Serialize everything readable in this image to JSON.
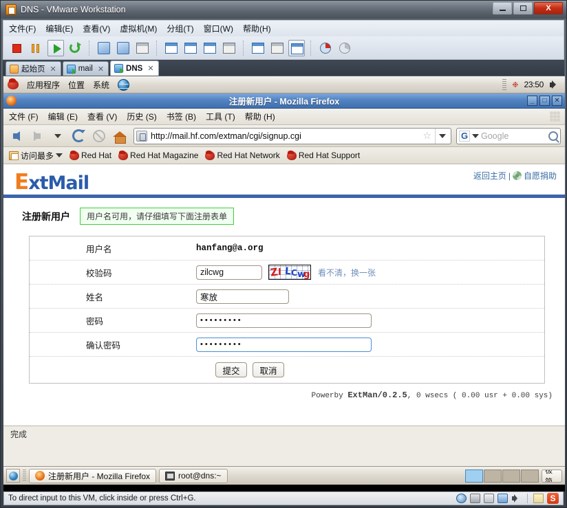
{
  "vmware": {
    "title": "DNS - VMware Workstation",
    "window_controls": {
      "minimize": "–",
      "maximize": "□",
      "close": "X"
    },
    "menus": [
      "文件(F)",
      "编辑(E)",
      "查看(V)",
      "虚拟机(M)",
      "分组(T)",
      "窗口(W)",
      "帮助(H)"
    ],
    "tabs": [
      {
        "label": "起始页",
        "close": "✕",
        "icon": "home-icon"
      },
      {
        "label": "mail",
        "close": "✕",
        "icon": "vm-icon"
      },
      {
        "label": "DNS",
        "close": "✕",
        "icon": "vm-icon"
      }
    ],
    "status_text": "To direct input to this VM, click inside or press Ctrl+G."
  },
  "gnome": {
    "menus": [
      "应用程序",
      "位置",
      "系统"
    ],
    "clock": "23:50"
  },
  "firefox": {
    "title": "注册新用户 - Mozilla Firefox",
    "window_controls": {
      "minimize": "_",
      "maximize": "□",
      "close": "✕"
    },
    "menus": [
      "文件 (F)",
      "编辑 (E)",
      "查看 (V)",
      "历史 (S)",
      "书签 (B)",
      "工具 (T)",
      "帮助 (H)"
    ],
    "url": "http://mail.hf.com/extman/cgi/signup.cgi",
    "search_placeholder": "Google",
    "search_engine": "G",
    "bookmarks": [
      {
        "label": "访问最多",
        "icon": "bookmarks-folder-icon"
      },
      {
        "label": "Red Hat",
        "icon": "redhat-icon"
      },
      {
        "label": "Red Hat Magazine",
        "icon": "redhat-icon"
      },
      {
        "label": "Red Hat Network",
        "icon": "redhat-icon"
      },
      {
        "label": "Red Hat Support",
        "icon": "redhat-icon"
      }
    ],
    "status": "完成"
  },
  "page": {
    "logo_first": "E",
    "logo_rest": "xtMail",
    "header_links": {
      "home": "返回主页",
      "sep": "|",
      "donate": "自愿捐助"
    },
    "section_title": "注册新用户",
    "banner": "用户名可用，请仔细填写下面注册表单",
    "form": {
      "rows": [
        {
          "label": "用户名",
          "value": "hanfang@a.org",
          "type": "static"
        },
        {
          "label": "校验码",
          "value": "zilcwg",
          "type": "text"
        },
        {
          "label": "姓名",
          "value": "寒放",
          "type": "text"
        },
        {
          "label": "密码",
          "value": "•••••••••",
          "type": "password"
        },
        {
          "label": "确认密码",
          "value": "•••••••••",
          "type": "password"
        }
      ],
      "captcha_chars": [
        "Z",
        "I",
        "L",
        "C",
        "w",
        "g"
      ],
      "captcha_link": "看不清，换一张",
      "submit": "提交",
      "cancel": "取消"
    },
    "footer_prefix": "Powerby ",
    "footer_app": "ExtMan/0.2.5",
    "footer_suffix": ", 0 wsecs ( 0.00 usr + 0.00 sys)"
  },
  "taskbar": {
    "items": [
      {
        "label": "注册新用户 - Mozilla Firefox",
        "icon": "firefox-icon"
      },
      {
        "label": "root@dns:~",
        "icon": "terminal-icon"
      }
    ],
    "ime_tip": "极简"
  }
}
